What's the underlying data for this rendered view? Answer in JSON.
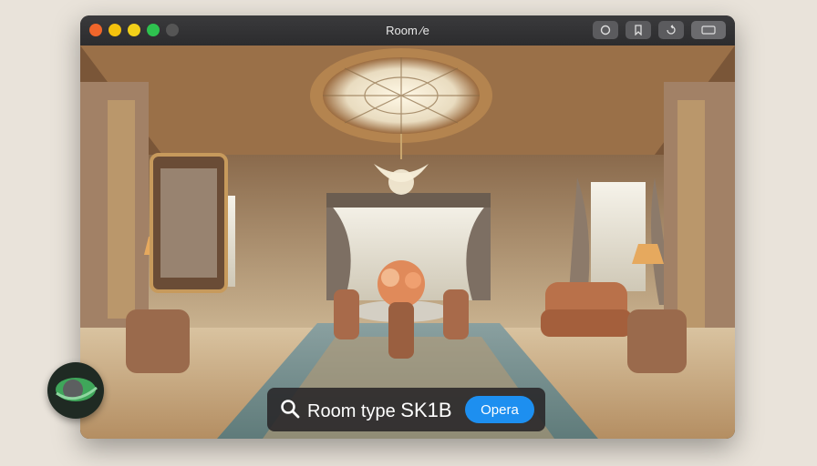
{
  "window": {
    "title": "Room ⁄e",
    "controls": [
      "close",
      "minimize",
      "minimize-alt",
      "zoom",
      "extra"
    ],
    "toolbar_buttons": [
      {
        "icon": "info-icon",
        "glyph": "0"
      },
      {
        "icon": "bookmark-icon",
        "glyph": "B"
      },
      {
        "icon": "share-icon",
        "glyph": "0"
      },
      {
        "icon": "sidebar-icon",
        "glyph": ""
      }
    ]
  },
  "search": {
    "icon": "search-icon",
    "query_prefix": "Room type ",
    "query_code": "SK1B",
    "open_label": "Opera"
  },
  "colors": {
    "accent": "#1d8ff0",
    "titlebar": "#2c2c2e",
    "badge_bg": "#1f2a23",
    "badge_leaf": "#3fa65a"
  },
  "badge": {
    "icon": "leaf-logo-icon"
  }
}
